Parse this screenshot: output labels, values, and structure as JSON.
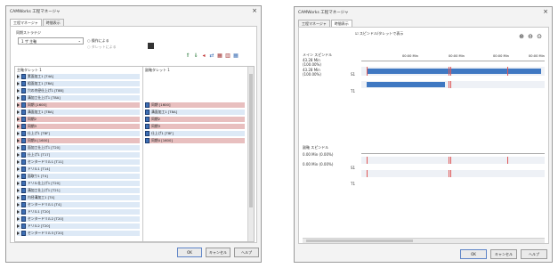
{
  "left_window": {
    "title": "CAMWorks 工程マネージャ",
    "close": "×",
    "tabs": [
      "工程マネージャ",
      "時間表示"
    ],
    "options_label": "同期ストラテジ",
    "combo_value": "1 ザ 主軸",
    "radio_1": "操作による",
    "radio_2": "タレットによる",
    "col_left_header": "主軸タレット 1",
    "col_right_header": "副軸タレット 1",
    "left_rows": [
      "素面加工1 [T4A]",
      "粗面加工1 [T8A]",
      "穴の内径仕上げ1 [T8B]",
      "溝加工仕上げ1 [T8A]",
      "同期 [1600]",
      "溝面加工1 [T8A]",
      "同期2",
      "同期3",
      "仕上げ1 [T8F]",
      "同期4 [1600]",
      "面加工仕上げ1 [T20]",
      "仕上げ1 [T17]",
      "センタードリル1 [T11]",
      "ドリル1 [T14]",
      "面取り1 [T4]",
      "ドリル仕上げ1 [T20]",
      "溝加工仕上げ1 [T21]",
      "内径溝加工1 [T4]",
      "センタードリル1 [T4]",
      "ドリル1 [T20]",
      "センタードリル2 [T20]",
      "ドリル2 [T20]",
      "センタードリル3 [T20]"
    ],
    "right_rows": [
      "",
      "",
      "",
      "",
      "同期 [1600]",
      "溝面加工1 [T8A]",
      "同期2",
      "同期3",
      "仕上げ1 [T8F]",
      "同期4 [1600]"
    ],
    "ok": "OK",
    "cancel": "キャンセル",
    "help": "ヘルプ"
  },
  "right_window": {
    "title": "CAMWorks 工程マネージャ",
    "close": "×",
    "tabs": [
      "工程マネージャ",
      "時間表示"
    ],
    "checkbox_label": "スピンドル/タレットで表示",
    "zoom_icons": [
      "zoom-in-icon",
      "zoom-out-icon",
      "zoom-fit-icon"
    ],
    "time_labels": [
      "00:00 Min",
      "00:00 Min",
      "00:00 Min",
      "00:00 Min"
    ],
    "upper_section": {
      "title": "メイン スピンドル",
      "line1": "43.28 Min",
      "line2": "(100.00%)",
      "line3": "43.28 Min",
      "line4": "(100.00%)",
      "row_a": "S1",
      "row_b": "T1"
    },
    "lower_section": {
      "title": "副軸 スピンドル",
      "line1": "0.00 Min (0.00%)",
      "line2": "0.00 Min (0.00%)",
      "row_a": "S1",
      "row_b": "T1"
    },
    "ok": "OK",
    "cancel": "キャンセル",
    "help": "ヘルプ"
  },
  "colors": {
    "row_highlight": "#e8bfbf",
    "row_normal": "#dde9f6",
    "timeline_blue": "#3f78c2",
    "sync_red": "#e05858"
  }
}
